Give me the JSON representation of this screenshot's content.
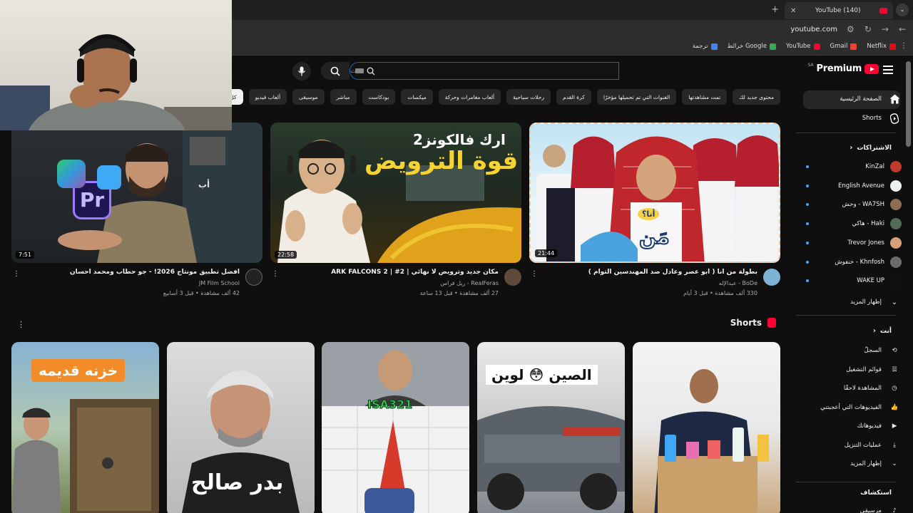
{
  "browser": {
    "tab_title": "(140) YouTube",
    "url": "youtube.com",
    "bookmarks": [
      {
        "label": "Netflix",
        "color": "#e50914"
      },
      {
        "label": "Gmail",
        "color": "#ea4335"
      },
      {
        "label": "YouTube",
        "color": "#ff0033"
      },
      {
        "label": "خرائط Google",
        "color": "#34a853"
      },
      {
        "label": "ترجمة",
        "color": "#4285f4"
      }
    ]
  },
  "header": {
    "logo_text": "Premium",
    "region": "SA",
    "search_placeholder": "بحث"
  },
  "chips": [
    "كل المحتوى",
    "ألعاب فيديو",
    "موسيقى",
    "مباشر",
    "بودكاست",
    "ميكسات",
    "ألعاب مغامرات وحركة",
    "رحلات سياحية",
    "كرة القدم",
    "الفنوات التي تم تحميلها مؤخرًا",
    "تمت مشاهدتها",
    "محتوى جديد لك"
  ],
  "sidebar": {
    "home": "الصفحة الرئيسية",
    "shorts": "Shorts",
    "subs_header": "الاشتراكات",
    "subs": [
      {
        "name": "KinZal",
        "color": "#c0392b"
      },
      {
        "name": "English Avenue",
        "color": "#ecf0f1"
      },
      {
        "name": "وحش - WA7SH",
        "color": "#8e6e53"
      },
      {
        "name": "هاكي - Haki",
        "color": "#556b5a"
      },
      {
        "name": "Trevor Jones",
        "color": "#d7a07a"
      },
      {
        "name": "خنفوش - Khnfosh",
        "color": "#6b6b6b"
      },
      {
        "name": "WAKE UP",
        "color": "#111111"
      }
    ],
    "show_more": "إظهار المزيد",
    "you_header": "أنت",
    "you_items": [
      "السجلّ",
      "قوائم التشغيل",
      "المشاهدة لاحقًا",
      "الفيديوهات التي أعجبتني",
      "فيديوهاتك",
      "عمليات التنزيل",
      "إظهار المزيد"
    ],
    "explore_header": "استكشاف",
    "explore_first": "مرسيقى"
  },
  "videos": [
    {
      "title": "بطولة من أنا ( ابو عصر وعادل ضد المهندسين التوام )",
      "channel": "BoDe - عبدالإله",
      "stats": "330 ألف مشاهدة • قبل 3 أيام",
      "duration": "21:44",
      "avatar_color": "#7fb3d5"
    },
    {
      "title": "مكان جديد وترويض لا نهائي | ARK FALCONS 2 | #2",
      "channel": "RealFeras - ريل فراس",
      "stats": "27 ألف مشاهدة • قبل 13 ساعة",
      "duration": "22:58",
      "avatar_color": "#5d4a3a"
    },
    {
      "title": "أفضل تطبيق مونتاج 2026! - جو حطاب ومحمد احسان",
      "channel": "JM Film School",
      "stats": "42 ألف مشاهدة • قبل 3 أسابيع",
      "duration": "7:51",
      "avatar_color": "#222222"
    }
  ],
  "thumb_text": {
    "v1_badge": "أنا؟",
    "v1_big": "مَن",
    "v2_line1": "ارك فالكونز2",
    "v2_line2": "قوة الترويض",
    "v3_pr": "Pr",
    "v3_ab": "أب"
  },
  "shorts": {
    "title": "Shorts",
    "items": [
      {
        "overlay": ""
      },
      {
        "overlay": "الصين 😳 لوين"
      },
      {
        "overlay": "ISA321"
      },
      {
        "overlay": "بدر صالح"
      },
      {
        "overlay": "خزنه قديمه"
      }
    ]
  }
}
